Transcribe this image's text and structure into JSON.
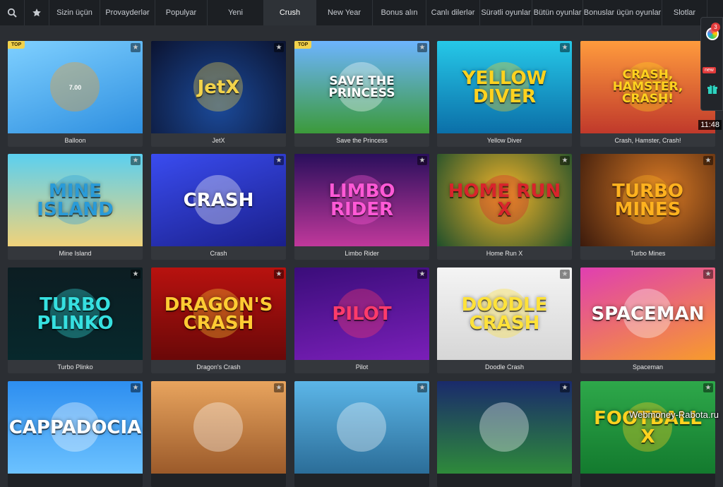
{
  "nav": {
    "tabs": [
      {
        "label": "Sizin üçün",
        "w": 72
      },
      {
        "label": "Provayderlər",
        "w": 78
      },
      {
        "label": "Populyar",
        "w": 74
      },
      {
        "label": "Yeni",
        "w": 80
      },
      {
        "label": "Crush",
        "w": 74,
        "active": true
      },
      {
        "label": "New Year",
        "w": 80
      },
      {
        "label": "Bonus alın",
        "w": 76
      },
      {
        "label": "Canlı dilerlər",
        "w": 76
      },
      {
        "label": "Sürətli oyunlar",
        "w": 74
      },
      {
        "label": "Bütün oyunlar",
        "w": 72
      },
      {
        "label": "Bonuslar üçün oyunlar",
        "w": 112
      },
      {
        "label": "Slotlar",
        "w": 64
      }
    ]
  },
  "side_panel": {
    "notification_count": "3",
    "new_label": "new"
  },
  "clock": "11:48",
  "watermark": "Webmoney-Rabota.ru",
  "games": [
    {
      "caption": "Balloon",
      "title": "",
      "top": true,
      "bg": "linear-gradient(160deg,#7fd0ff,#2e8fe0)",
      "accent": "#ff9f1a",
      "thumb_text": "7.00"
    },
    {
      "caption": "JetX",
      "title": "JetX",
      "top": false,
      "bg": "radial-gradient(circle at 50% 70%,#1b4a9a,#0b1330)",
      "accent": "#f3d34a"
    },
    {
      "caption": "Save the Princess",
      "title": "SAVE THE PRINCESS",
      "top": true,
      "bg": "linear-gradient(180deg,#6db4ff,#3c9a3a)",
      "accent": "#ffffff"
    },
    {
      "caption": "Yellow Diver",
      "title": "YELLOW DIVER",
      "top": false,
      "bg": "linear-gradient(180deg,#26c8e8,#0b6fa8)",
      "accent": "#ffd21f"
    },
    {
      "caption": "Crash, Hamster, Crash!",
      "title": "CRASH, HAMSTER, CRASH!",
      "top": false,
      "bg": "linear-gradient(180deg,#ff9b3d,#c0392b)",
      "accent": "#ffd21f"
    },
    {
      "caption": "Mine Island",
      "title": "MINE ISLAND",
      "top": false,
      "bg": "linear-gradient(180deg,#5bd0f0,#f0d27a)",
      "accent": "#2a9bd8"
    },
    {
      "caption": "Crash",
      "title": "CRASH",
      "top": false,
      "bg": "linear-gradient(160deg,#3a4cf0,#1a1f8a)",
      "accent": "#ffffff"
    },
    {
      "caption": "Limbo Rider",
      "title": "LIMBO RIDER",
      "top": false,
      "bg": "linear-gradient(180deg,#2a0f5c,#c0389b)",
      "accent": "#ff59d6"
    },
    {
      "caption": "Home Run X",
      "title": "HOME RUN X",
      "top": false,
      "bg": "radial-gradient(circle at 50% 45%,#f6b52a,#1f4f2b)",
      "accent": "#d8242c"
    },
    {
      "caption": "Turbo Mines",
      "title": "TURBO MINES",
      "top": false,
      "bg": "radial-gradient(circle at 60% 40%,#d87a25,#3b1a0c)",
      "accent": "#ffb21f"
    },
    {
      "caption": "Turbo Plinko",
      "title": "TURBO PLINKO",
      "top": false,
      "bg": "linear-gradient(180deg,#0c1d22,#07282c)",
      "accent": "#36e0e0"
    },
    {
      "caption": "Dragon's Crash",
      "title": "DRAGON'S CRASH",
      "top": false,
      "bg": "linear-gradient(180deg,#b8120f,#6a0808)",
      "accent": "#ffcc33"
    },
    {
      "caption": "Pilot",
      "title": "PILOT",
      "top": false,
      "bg": "linear-gradient(170deg,#3a0d7a,#7a1fb8)",
      "accent": "#ff3b6b"
    },
    {
      "caption": "Doodle Crash",
      "title": "DOODLE CRASH",
      "top": false,
      "bg": "linear-gradient(180deg,#f4f4f4,#d6d6d6)",
      "accent": "#ffe23a"
    },
    {
      "caption": "Spaceman",
      "title": "SPACEMAN",
      "top": false,
      "bg": "linear-gradient(160deg,#e03fb1,#f79b2c)",
      "accent": "#ffffff"
    },
    {
      "caption": "",
      "title": "CAPPADOCIA",
      "top": false,
      "bg": "linear-gradient(180deg,#2d8ef0,#6cc2ff)",
      "accent": "#ffffff"
    },
    {
      "caption": "",
      "title": "",
      "top": false,
      "bg": "linear-gradient(180deg,#e8a45e,#9b5a2a)",
      "accent": "#ffffff"
    },
    {
      "caption": "",
      "title": "",
      "top": false,
      "bg": "linear-gradient(180deg,#5cb6e8,#2b6d98)",
      "accent": "#ffffff"
    },
    {
      "caption": "",
      "title": "",
      "top": false,
      "bg": "linear-gradient(180deg,#1a2a6c,#2e8a3a)",
      "accent": "#ffffff"
    },
    {
      "caption": "",
      "title": "FOOTBALL X",
      "top": false,
      "bg": "linear-gradient(180deg,#2ea84a,#137a2e)",
      "accent": "#ffd21f"
    }
  ]
}
